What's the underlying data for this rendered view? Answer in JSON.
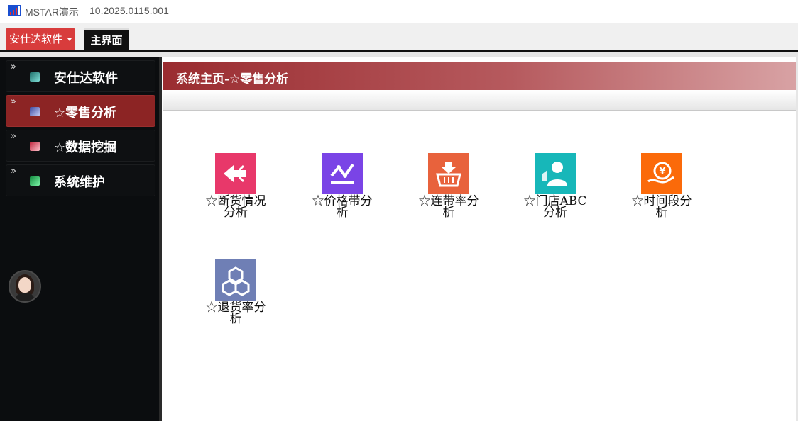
{
  "window": {
    "title": "MSTAR演示",
    "version": "10.2025.0115.001"
  },
  "toolbar": {
    "brand_label": "安仕达软件",
    "main_tab_label": "主界面"
  },
  "sidebar": {
    "items": [
      {
        "label": "安仕达软件",
        "active": false,
        "icon_color": "#4db6ac"
      },
      {
        "label": "☆零售分析",
        "active": true,
        "icon_color": "#7e8ce0"
      },
      {
        "label": "☆数据挖掘",
        "active": false,
        "icon_color": "#f06b7f"
      },
      {
        "label": "系统维护",
        "active": false,
        "icon_color": "#3bd16f"
      }
    ],
    "chevron": "»"
  },
  "page": {
    "title": "系统主页-☆零售分析"
  },
  "tiles": [
    {
      "line1": "☆断货情况",
      "line2": "分析",
      "icon": "arrow-left-icon",
      "color": "#e8386a"
    },
    {
      "line1": "☆价格带分",
      "line2": "析",
      "icon": "price-trend-icon",
      "color": "#7a44e6"
    },
    {
      "line1": "☆连带率分",
      "line2": "析",
      "icon": "basket-icon",
      "color": "#e8623c"
    },
    {
      "line1": "☆门店ABC",
      "line2": "分析",
      "icon": "store-person-icon",
      "color": "#17b7b9"
    },
    {
      "line1": "☆时间段分",
      "line2": "析",
      "icon": "coin-hand-icon",
      "color": "#fb6a0a"
    },
    {
      "line1": "☆退货率分",
      "line2": "析",
      "icon": "boxes-icon",
      "color": "#6f7fb5"
    }
  ]
}
